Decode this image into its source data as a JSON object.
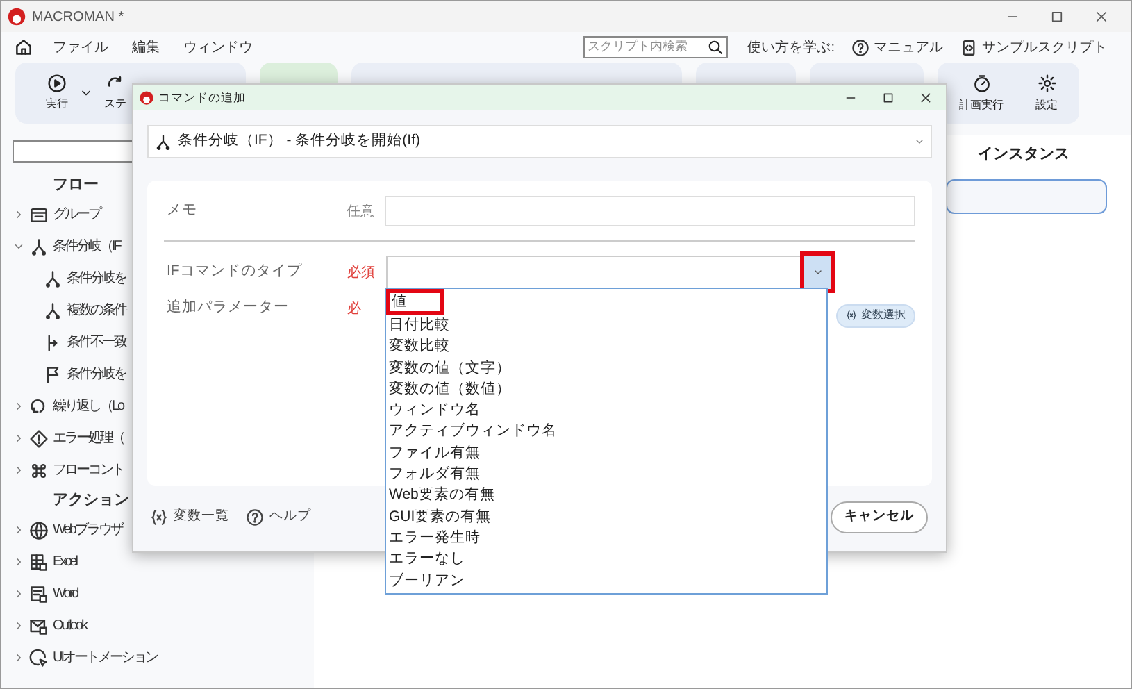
{
  "window": {
    "title": "MACROMAN *"
  },
  "menu": [
    "ファイル",
    "編集",
    "ウィンドウ"
  ],
  "search": {
    "placeholder": "スクリプト内検索"
  },
  "help_label": "使い方を学ぶ:",
  "help_links": [
    {
      "kind": "manual",
      "label": "マニュアル"
    },
    {
      "kind": "samples",
      "label": "サンプルスクリプト"
    }
  ],
  "toolbar_left": [
    {
      "kind": "run",
      "label": "実行"
    },
    {
      "kind": "step",
      "label": "ステ"
    }
  ],
  "toolbar_right": [
    {
      "kind": "schedule",
      "label": "計画実行"
    },
    {
      "kind": "settings",
      "label": "設定"
    }
  ],
  "sidebar": {
    "sections": [
      {
        "title": "フロー",
        "items": [
          {
            "label": "グループ",
            "kind": "group",
            "expanded": false
          },
          {
            "label": "条件分岐（IF",
            "kind": "branch",
            "expanded": true,
            "children": [
              {
                "label": "条件分岐を",
                "kind": "branch"
              },
              {
                "label": "複数の条件",
                "kind": "branch"
              },
              {
                "label": "条件不一致",
                "kind": "mismatch"
              },
              {
                "label": "条件分岐を",
                "kind": "flag"
              }
            ]
          },
          {
            "label": "繰り返し（Lo",
            "kind": "loop",
            "expanded": false
          },
          {
            "label": "エラー処理（",
            "kind": "error",
            "expanded": false
          },
          {
            "label": "フローコント",
            "kind": "command",
            "expanded": false
          }
        ]
      },
      {
        "title": "アクション",
        "items": [
          {
            "label": "Webブラウザ",
            "kind": "globe",
            "expanded": false
          },
          {
            "label": "Excel",
            "kind": "sheet",
            "expanded": false
          },
          {
            "label": "Word",
            "kind": "doc",
            "expanded": false
          },
          {
            "label": "Outlook",
            "kind": "mail",
            "expanded": false
          },
          {
            "label": "UIオートメーション",
            "kind": "cursor",
            "expanded": false
          }
        ]
      }
    ]
  },
  "instances_header": "インスタンス",
  "dialog": {
    "title": "コマンドの追加",
    "command": "条件分岐（IF） - 条件分岐を開始(If)",
    "fields": [
      {
        "kind": "text",
        "label": "メモ",
        "requirement": "任意",
        "required": false
      },
      {
        "kind": "select",
        "label": "IFコマンドのタイプ",
        "requirement": "必須",
        "required": true,
        "button_highlighted": true
      },
      {
        "kind": "variable",
        "label": "追加パラメーター",
        "requirement": "必",
        "required": true,
        "button": "変数選択"
      }
    ],
    "footer_links": [
      {
        "kind": "variables",
        "label": "変数一覧"
      },
      {
        "kind": "help",
        "label": "ヘルプ"
      }
    ],
    "cancel": "キャンセル",
    "options": [
      {
        "label": "値",
        "highlighted": true
      },
      {
        "label": "日付比較",
        "highlighted": false
      },
      {
        "label": "変数比較",
        "highlighted": false
      },
      {
        "label": "変数の値（文字）",
        "highlighted": false
      },
      {
        "label": "変数の値（数値）",
        "highlighted": false
      },
      {
        "label": "ウィンドウ名",
        "highlighted": false
      },
      {
        "label": "アクティブウィンドウ名",
        "highlighted": false
      },
      {
        "label": "ファイル有無",
        "highlighted": false
      },
      {
        "label": "フォルダ有無",
        "highlighted": false
      },
      {
        "label": "Web要素の有無",
        "highlighted": false
      },
      {
        "label": "GUI要素の有無",
        "highlighted": false
      },
      {
        "label": "エラー発生時",
        "highlighted": false
      },
      {
        "label": "エラーなし",
        "highlighted": false
      },
      {
        "label": "ブーリアン",
        "highlighted": false
      }
    ]
  }
}
